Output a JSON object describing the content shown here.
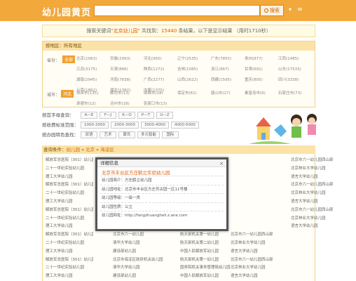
{
  "header": {
    "logo": "幼儿园黄页",
    "search_placeholder": "",
    "search_button": "搜索",
    "icons": [
      "arrow-down-icon",
      "mail-icon"
    ]
  },
  "result": {
    "prefix": "搜索关键词",
    "keyword": "\"北京幼儿园\"",
    "mid": "共找到：",
    "count": "15440",
    "suffix": "条结果，以下是显示结果",
    "time": "（用时1710秒）"
  },
  "region": {
    "title": "按地区：所有地区",
    "province_label": "省份：",
    "province_all": "全部",
    "provinces": [
      "北京(1063)",
      "安徽(2993)",
      "河北(950)",
      "辽宁(2535)",
      "广东(7855)",
      "贵州(877)",
      "江西(1485)",
      "江苏(3175)",
      "天津(886)",
      "陕西(1272)",
      "吉林(1085)",
      "浙江(867)",
      "甘肃(691)",
      "山东(17533)",
      "湖南(2945)",
      "河南(7838)",
      "广西(2277)",
      "山西(2622)",
      "西藏(1595)",
      "重庆(805)",
      "四川(3338)",
      "云南(1862)",
      "湖北(1382)",
      "内蒙(1375)"
    ],
    "city_label": "城市：",
    "city_selected": "河北",
    "cities": [
      "邢台市(135)",
      "廊坊市(13)",
      "邯郸市(28)",
      "保定市(61)",
      "唐山市(27)",
      "秦皇岛市(6)",
      "石家庄市(73)",
      "承德市(12)",
      "沧州市(18)",
      "张家口市(13)"
    ]
  },
  "filters": {
    "letter": {
      "label": "按首字母查询：",
      "chips": [
        "A—E",
        "F—J",
        "K—O",
        "P—T",
        "U—Z"
      ]
    },
    "fee": {
      "label": "按收费标准范围：",
      "chips": [
        "1000-2000",
        "2000-3000",
        "3000-4000",
        "4000-5000"
      ]
    },
    "feature": {
      "label": "按办园特色查找：",
      "chips": [
        "双语",
        "艺术",
        "蒙氏",
        "多元智能",
        "国际"
      ]
    }
  },
  "condition": {
    "label": "查询条件：",
    "path1": "幼儿园",
    "sep": " » ",
    "path2": "北京",
    "path3": "海淀区"
  },
  "rows": [
    [
      "解放军总医院（301）幼儿园",
      "",
      "",
      "",
      "北京市六一幼儿园西山部"
    ],
    [
      "二十一世纪实验幼儿园",
      "",
      "",
      "",
      "北京林业大学幼儿园"
    ],
    [
      "理工大学幼儿园",
      "",
      "",
      "",
      "语言大学幼儿园"
    ],
    [
      "解放军总医院（301）幼儿园",
      "",
      "",
      "",
      "北京市六一幼儿园西山部"
    ],
    [
      "二十一世纪实验幼儿园",
      "",
      "",
      "",
      "北京林业大学幼儿园"
    ],
    [
      "理工大学幼儿园",
      "",
      "",
      "",
      "语言大学幼儿园"
    ],
    [
      "解放军总医院（301）幼儿园",
      "",
      "",
      "",
      "北京市六一幼儿园西山部"
    ],
    [
      "二十一世纪实验幼儿园",
      "",
      "",
      "",
      "北京林业大学幼儿园"
    ],
    [
      "理工大学幼儿园",
      "",
      "",
      "",
      "语言大学幼儿园"
    ],
    [
      "解放军总医院（301）幼儿园",
      "北京市六一幼儿园",
      "航天部机关第一幼儿园",
      "北京市六一幼儿园西山部",
      ""
    ],
    [
      "二十一世纪实验幼儿园",
      "清华大学幼儿园",
      "航天部机关第二幼儿园",
      "北京林业大学幼儿园",
      ""
    ],
    [
      "理工大学幼儿园",
      "建设部幼儿园",
      "中国人民解放军幼儿园",
      "语言大学幼儿园",
      ""
    ],
    [
      "解放军总医院（301）幼儿园",
      "北京市海淀区政府机关幼儿园",
      "航天部机关第一幼儿园",
      "北京市六一幼儿园西山部",
      ""
    ],
    [
      "二十一世纪实验幼儿园",
      "清华大学幼儿园",
      "国务院机关事务管理局幼儿园",
      "北京林业大学幼儿园",
      ""
    ],
    [
      "理工大学幼儿园",
      "建设部幼儿园",
      "中国人民解放军幼儿园",
      "语言大学幼儿园",
      ""
    ]
  ],
  "modal": {
    "header": "详细信息",
    "close": "×",
    "title": "北京市丰台区方庄鹤立实验幼儿园",
    "lines": [
      "幼儿园简介：方庄鹤立幼儿园",
      "幼儿园地址：北京市丰台区方庄芳古园一区11号楼",
      "幼儿园等级：一级一类",
      "幼儿园性质：公立",
      "幼儿园网址：http://fangzhuangheli.z.ane.com"
    ]
  },
  "colors": {
    "header_bg": "#f2a83a",
    "accent": "#e05a00",
    "region_bg": "#fbe3a8"
  }
}
